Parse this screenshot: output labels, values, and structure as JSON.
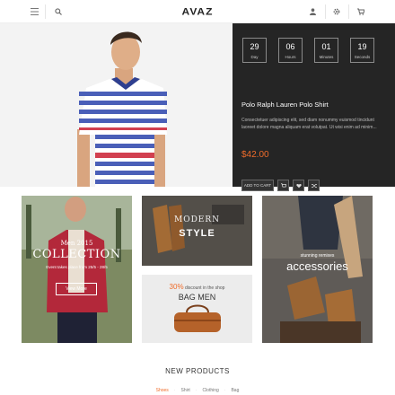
{
  "header": {
    "logo": "AVAZ",
    "icons": [
      "menu-icon",
      "search-icon",
      "user-icon",
      "settings-icon",
      "cart-icon"
    ]
  },
  "hero": {
    "countdown": [
      {
        "value": "29",
        "unit": "Day"
      },
      {
        "value": "06",
        "unit": "Hours"
      },
      {
        "value": "01",
        "unit": "Minutes"
      },
      {
        "value": "19",
        "unit": "Seconds"
      }
    ],
    "product_title": "Polo Ralph Lauren Polo Shirt",
    "description": "Consectetuer adipiscing elit, sed diam nonummy euismod tincidunt laoreet dolore magna aliquam erat volutpat. Ut wisi enim ad minim...",
    "price": "$42.00",
    "add_to_cart_label": "ADD TO CART"
  },
  "banners": {
    "collection": {
      "small": "Men 2015",
      "big": "COLLECTION",
      "sub": "Event takes place from 25/5 - 28/5",
      "button": "View More"
    },
    "modern": {
      "line1": "MODERN",
      "line2": "STYLE"
    },
    "bag": {
      "percent": "30%",
      "discount": "discount in the shop",
      "title": "BAG MEN"
    },
    "accessories": {
      "small": "stunning remixes",
      "big": "accessories"
    }
  },
  "new_products": {
    "title": "NEW PRODUCTS",
    "filters": [
      "Shoes",
      "Shirt",
      "Clothing",
      "Bag"
    ],
    "active_filter": "Shoes"
  },
  "colors": {
    "accent": "#ef6c2b",
    "panel": "#252525"
  }
}
